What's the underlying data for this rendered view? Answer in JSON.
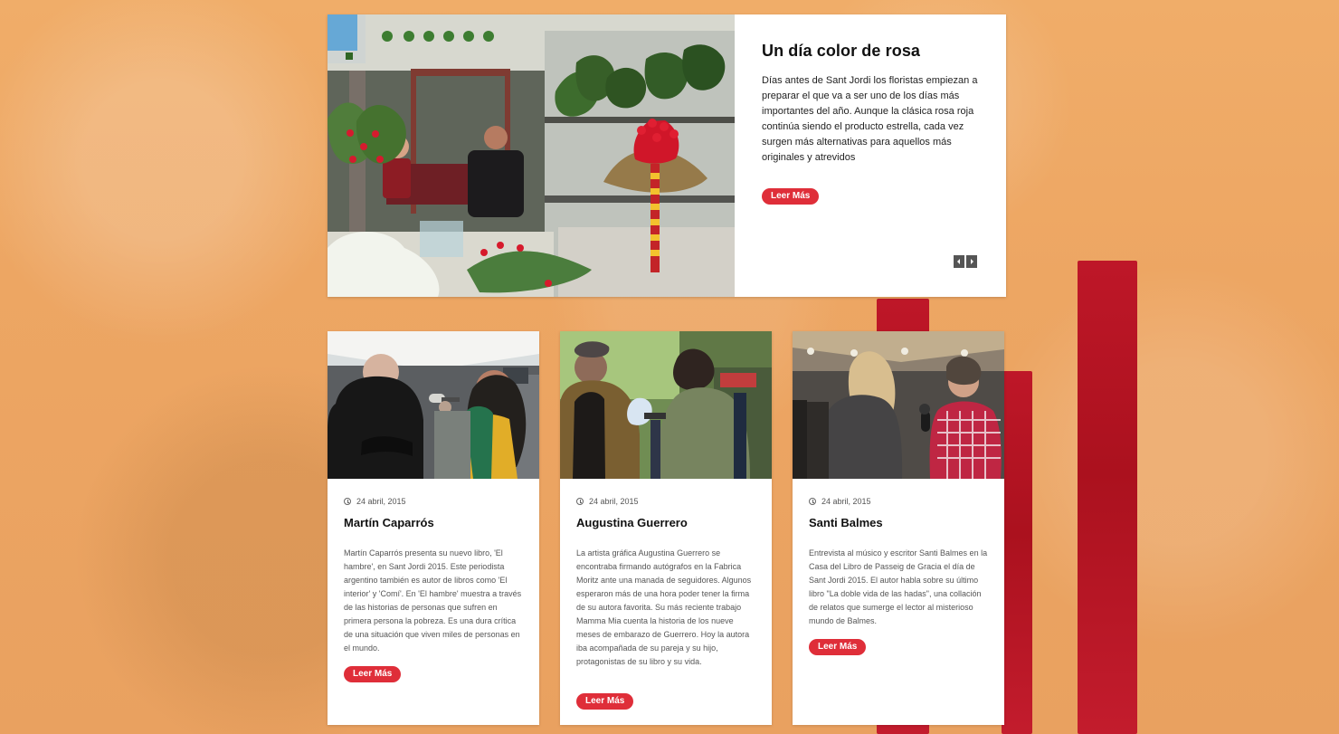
{
  "featured": {
    "title": "Un día color de rosa",
    "description": "Días antes de Sant Jordi los floristas empiezan a preparar el que va a ser uno de los días más importantes del año. Aunque la clásica rosa roja continúa siendo el producto estrella, cada vez surgen más alternativas para aquellos más originales y atrevidos",
    "read_more": "Leer Más"
  },
  "cards": [
    {
      "date": "24 abril, 2015",
      "title": "Martín Caparrós",
      "text": "Martín Caparrós presenta su nuevo libro, 'El hambre', en Sant Jordi 2015. Este periodista argentino también es autor de libros como 'El interior' y 'Comí'. En 'El hambre' muestra a través de las historias de personas que sufren en primera persona la pobreza. Es una dura crítica de una situación que viven miles de personas en el mundo.",
      "read_more": "Leer Más"
    },
    {
      "date": "24 abril, 2015",
      "title": "Augustina Guerrero",
      "text": "La artista gráfica Augustina Guerrero se encontraba firmando autógrafos en la Fabrica Moritz ante una manada de seguidores. Algunos esperaron más de una hora poder tener la firma de su autora favorita. Su más reciente trabajo Mamma Mia cuenta la historia de los nueve meses de embarazo de Guerrero. Hoy la autora iba acompañada de su pareja y su hijo, protagonistas de su libro y su vida.",
      "read_more": "Leer Más"
    },
    {
      "date": "24 abril, 2015",
      "title": "Santi Balmes",
      "text": "Entrevista al músico y escritor Santi Balmes en la Casa del Libro de Passeig de Gracia el día de Sant Jordi 2015. El autor habla sobre su último libro \"La doble vida de las hadas\", una collación de relatos que sumerge el lector al misterioso mundo de Balmes.",
      "read_more": "Leer Más"
    }
  ],
  "colors": {
    "background": "#eda663",
    "card": "#ffffff",
    "accent": "#df2e39",
    "stripe": "#b81929",
    "text_dark": "#111111",
    "text_body": "#555555",
    "arrow_bg": "#555555"
  },
  "icons": {
    "date": "clock-icon",
    "prev": "chevron-left-icon",
    "next": "chevron-right-icon"
  }
}
